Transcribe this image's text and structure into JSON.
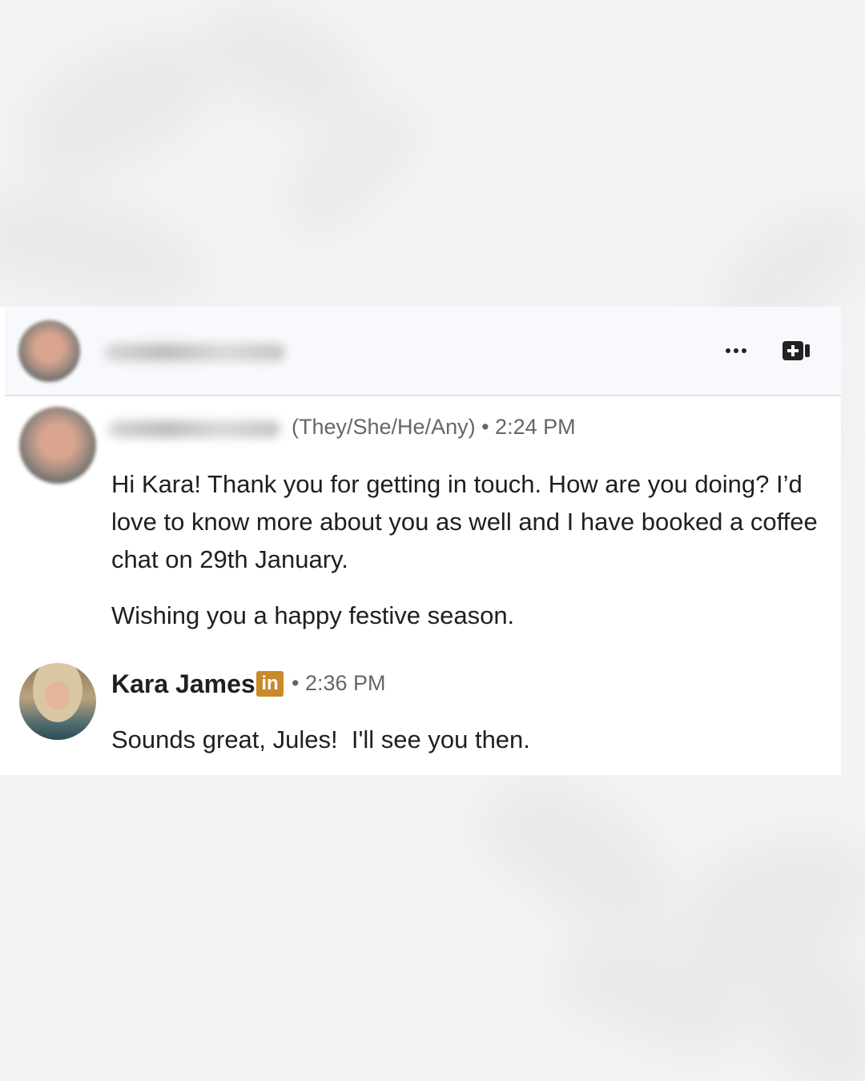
{
  "conversation": {
    "header": {
      "more_icon": "more-horizontal-icon",
      "video_icon": "video-call-icon"
    },
    "messages": [
      {
        "pronouns_time": "(They/She/He/Any) • 2:24 PM",
        "paragraphs": [
          "Hi Kara! Thank you for getting in touch. How are you doing? I’d love to know more about you as well and I have booked a coffee chat on 29th January.",
          "Wishing you a happy festive season."
        ]
      },
      {
        "sender": "Kara James",
        "badge": "in",
        "time": "• 2:36 PM",
        "paragraphs": [
          "Sounds great, Jules!  I'll see you then."
        ]
      }
    ],
    "colors": {
      "badge": "#c98a2b",
      "header_bg": "#f8f9fc",
      "text": "#1f1f1f",
      "meta": "#666666"
    }
  }
}
